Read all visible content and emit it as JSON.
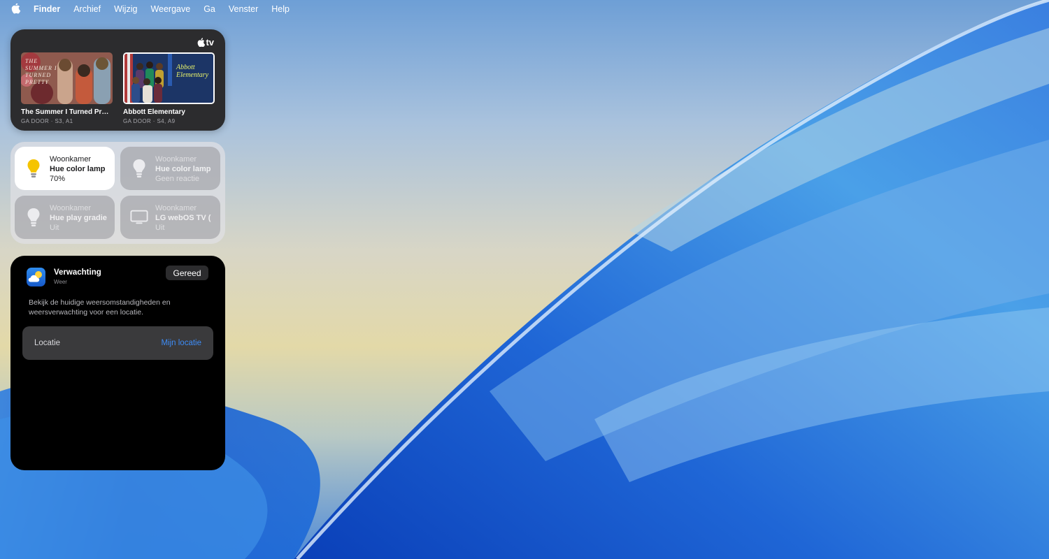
{
  "menubar": {
    "apple_icon": "apple-logo-icon",
    "items": [
      "Finder",
      "Archief",
      "Wijzig",
      "Weergave",
      "Ga",
      "Venster",
      "Help"
    ]
  },
  "tv_widget": {
    "logo_text": "tv",
    "shows": [
      {
        "title": "The Summer I Turned Pr…",
        "subtitle": "GA DOOR · S3, A1",
        "art_text": "THE SUMMER I TURNED PRETTY"
      },
      {
        "title": "Abbott Elementary",
        "subtitle": "GA DOOR · S4, A9",
        "art_text": "Abbott Elementary"
      }
    ]
  },
  "home_widget": {
    "tiles": [
      {
        "room": "Woonkamer",
        "name": "Hue color lamp",
        "status": "70%",
        "icon": "lightbulb-on-icon",
        "state": "on"
      },
      {
        "room": "Woonkamer",
        "name": "Hue color lamp",
        "status": "Geen reactie",
        "icon": "lightbulb-icon",
        "state": "no-response"
      },
      {
        "room": "Woonkamer",
        "name": "Hue play gradie",
        "status": "Uit",
        "icon": "lightbulb-icon",
        "state": "off"
      },
      {
        "room": "Woonkamer",
        "name": "LG webOS TV (",
        "status": "Uit",
        "icon": "tv-icon",
        "state": "off"
      }
    ]
  },
  "weather_widget": {
    "title": "Verwachting",
    "subtitle": "Weer",
    "done_label": "Gereed",
    "description": "Bekijk de huidige weersomstandigheden en weersverwachting voor een locatie.",
    "location_label": "Locatie",
    "location_value": "Mijn locatie",
    "icon": "weather-app-icon"
  },
  "colors": {
    "accent": "#3e8cf6",
    "bulb_on": "#f5c400",
    "widget_dark": "#2c2c2e"
  }
}
